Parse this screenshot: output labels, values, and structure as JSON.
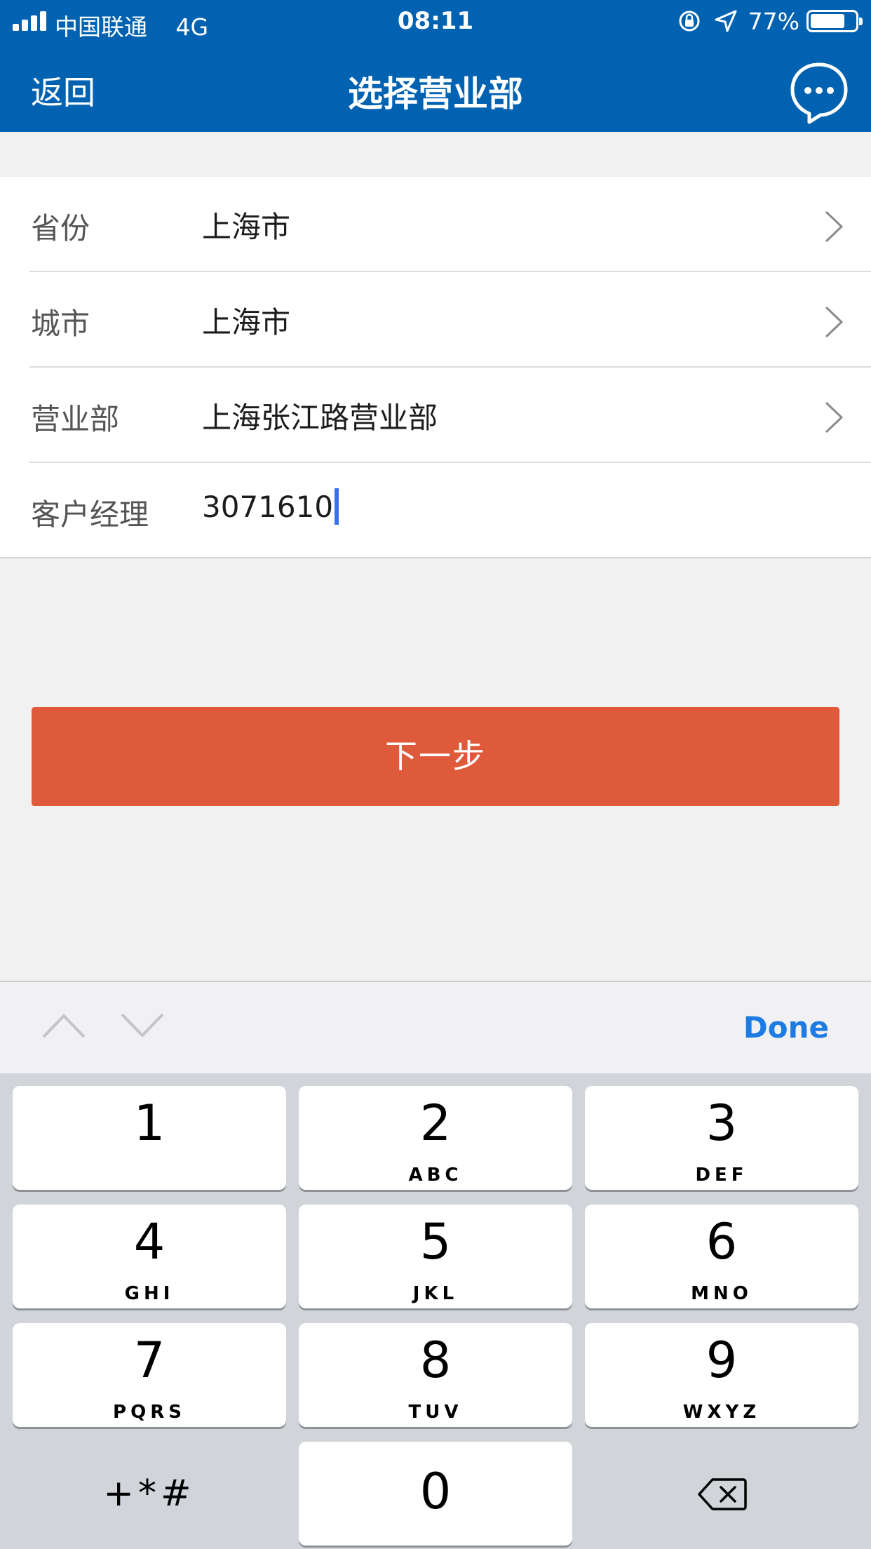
{
  "status_bar": {
    "carrier": "中国联通",
    "network": "4G",
    "time": "08:11",
    "battery_percent": "77%",
    "battery_level": 0.77
  },
  "nav": {
    "back_label": "返回",
    "title": "选择营业部",
    "chat_icon": "chat-bubble-icon"
  },
  "form": {
    "rows": [
      {
        "label": "省份",
        "value": "上海市",
        "has_chevron": true
      },
      {
        "label": "城市",
        "value": "上海市",
        "has_chevron": true
      },
      {
        "label": "营业部",
        "value": "上海张江路营业部",
        "has_chevron": true
      },
      {
        "label": "客户经理",
        "value": "3071610",
        "has_chevron": false
      }
    ]
  },
  "next_button": {
    "label": "下一步"
  },
  "accessory": {
    "prev_icon": "chevron-up-icon",
    "next_icon": "chevron-down-icon",
    "done_label": "Done"
  },
  "keypad": {
    "keys": [
      {
        "num": "1",
        "letters": ""
      },
      {
        "num": "2",
        "letters": "ABC"
      },
      {
        "num": "3",
        "letters": "DEF"
      },
      {
        "num": "4",
        "letters": "GHI"
      },
      {
        "num": "5",
        "letters": "JKL"
      },
      {
        "num": "6",
        "letters": "MNO"
      },
      {
        "num": "7",
        "letters": "PQRS"
      },
      {
        "num": "8",
        "letters": "TUV"
      },
      {
        "num": "9",
        "letters": "WXYZ"
      }
    ],
    "symbols": "+*#",
    "zero": "0",
    "delete_icon": "backspace-icon"
  },
  "colors": {
    "nav_bg": "#0062b1",
    "next_button": "#df5a3a",
    "done": "#1d7be4",
    "caret": "#3a6ff2"
  }
}
